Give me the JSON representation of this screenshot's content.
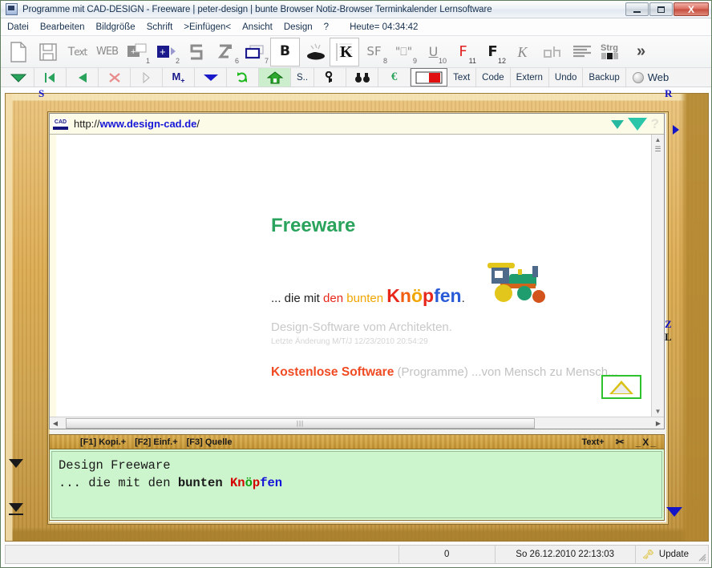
{
  "window": {
    "title": "Programme mit CAD-DESIGN - Freeware | peter-design | bunte Browser Notiz-Browser Terminkalender Lernsoftware",
    "icon": "app-icon",
    "minimize_label": "–",
    "maximize_label": "□",
    "close_label": "X"
  },
  "menu": {
    "items": [
      {
        "label": "Datei"
      },
      {
        "label": "Bearbeiten"
      },
      {
        "label": "Bildgröße"
      },
      {
        "label": "Schrift"
      },
      {
        "label": ">Einfügen<"
      },
      {
        "label": "Ansicht"
      },
      {
        "label": "Design"
      },
      {
        "label": "?"
      }
    ],
    "clock": "Heute= 04:34:42"
  },
  "toolbar_main": {
    "buttons": [
      {
        "name": "new-document-icon",
        "glyph": "□",
        "sub": ""
      },
      {
        "name": "save-icon",
        "glyph": "💾",
        "sub": ""
      },
      {
        "name": "text-icon",
        "glyph": "Text",
        "sub": ""
      },
      {
        "name": "web-icon",
        "glyph": "WEB",
        "sub": ""
      },
      {
        "name": "insert-plus-1-icon",
        "glyph": "+",
        "sub": "1"
      },
      {
        "name": "insert-plus-2-icon",
        "glyph": "+",
        "sub": "2"
      },
      {
        "name": "shape-s-icon",
        "glyph": "S",
        "sub": ""
      },
      {
        "name": "shape-z-6-icon",
        "glyph": "Z",
        "sub": "6"
      },
      {
        "name": "frame-7-icon",
        "glyph": "▭",
        "sub": "7"
      },
      {
        "name": "bold-b-icon",
        "glyph": "B",
        "sub": ""
      },
      {
        "name": "paint-icon",
        "glyph": "⚒",
        "sub": ""
      },
      {
        "name": "kapitel-k-icon",
        "glyph": "K",
        "sub": ""
      },
      {
        "name": "sf-8-icon",
        "glyph": "SF",
        "sub": "8"
      },
      {
        "name": "quote-a-9-icon",
        "glyph": "\"A\"",
        "sub": "9"
      },
      {
        "name": "underline-10-icon",
        "glyph": "U",
        "sub": "10"
      },
      {
        "name": "f11-icon",
        "glyph": "F",
        "sub": "11"
      },
      {
        "name": "f12-icon",
        "glyph": "F",
        "sub": "12"
      },
      {
        "name": "italic-k-icon",
        "glyph": "K",
        "sub": ""
      },
      {
        "name": "ah-icon",
        "glyph": "aA",
        "sub": ""
      },
      {
        "name": "align-left-icon",
        "glyph": "≡",
        "sub": ""
      },
      {
        "name": "strg-icon",
        "glyph": "Strg",
        "sub": ""
      },
      {
        "name": "more-chevron-icon",
        "glyph": "»",
        "sub": ""
      }
    ]
  },
  "toolbar_nav": {
    "buttons": [
      {
        "name": "dropdown-green-icon",
        "label": ""
      },
      {
        "name": "first-page-icon",
        "label": ""
      },
      {
        "name": "previous-page-icon",
        "label": ""
      },
      {
        "name": "delete-x-icon",
        "label": ""
      },
      {
        "name": "next-page-icon",
        "label": ""
      },
      {
        "name": "makro-m-icon",
        "label": "M"
      },
      {
        "name": "dropdown-blue-icon",
        "label": ""
      },
      {
        "name": "refresh-icon",
        "label": ""
      },
      {
        "name": "home-icon",
        "label": ""
      },
      {
        "name": "search-s-button",
        "label": "S.."
      },
      {
        "name": "key-icon",
        "label": ""
      },
      {
        "name": "binoculars-icon",
        "label": ""
      },
      {
        "name": "euro-icon",
        "label": ""
      },
      {
        "name": "color-swatch-icon",
        "label": ""
      }
    ],
    "labels": [
      {
        "name": "text-button",
        "label": "Text"
      },
      {
        "name": "code-button",
        "label": "Code"
      },
      {
        "name": "extern-button",
        "label": "Extern"
      },
      {
        "name": "undo-button",
        "label": "Undo"
      },
      {
        "name": "backup-button",
        "label": "Backup"
      }
    ],
    "web_label": "Web"
  },
  "frame_marks": {
    "top_left": "S",
    "top_right": "R",
    "right_z": "Z",
    "right_l": "L"
  },
  "browser": {
    "badge": "CAD",
    "url_protocol": "http://",
    "url_domain": "www.design-cad.de",
    "url_path": "/",
    "help_glyph": "?"
  },
  "page": {
    "heading": "Freeware",
    "tagline_prefix": "... die mit ",
    "tagline_den": "den ",
    "tagline_bunten": "bunten ",
    "tagline_k": "K",
    "tagline_n": "n",
    "tagline_oe": "ö",
    "tagline_p": "p",
    "tagline_fen": "fen",
    "tagline_dot": ".",
    "subtitle": "Design-Software vom Architekten.",
    "last_change": "Letzte Änderung M/T/J 12/23/2010 20:54:29",
    "kostenlose_bold": "Kostenlose Software",
    "kostenlose_rest": " (Programme) ...von Mensch zu Mensch...",
    "scroll_thumb_grip": "|||"
  },
  "editor": {
    "key_f1": "[F1] Kopi.+",
    "key_f2": "[F2] Einf.+",
    "key_f3": "[F3] Quelle",
    "text_plus": "Text+",
    "scissors": "✂",
    "minimize": "_",
    "close": "X",
    "restore": "_",
    "line1": "Design Freeware",
    "line2_prefix": "... die mit den ",
    "line2_bunten": "bunten ",
    "line2_k": "K",
    "line2_n": "n",
    "line2_oe": "ö",
    "line2_p": "p",
    "line2_fen": "fen"
  },
  "statusbar": {
    "left": "",
    "count": "0",
    "datetime": "So 26.12.2010 22:13:03",
    "update_label": "Update",
    "key_icon": "🗝"
  },
  "colors": {
    "accent_green": "#2aa35c",
    "accent_orange": "#ef4a22",
    "link_blue": "#1717d8",
    "wood": "#d9a950",
    "editor_green": "#cdf5cd"
  }
}
